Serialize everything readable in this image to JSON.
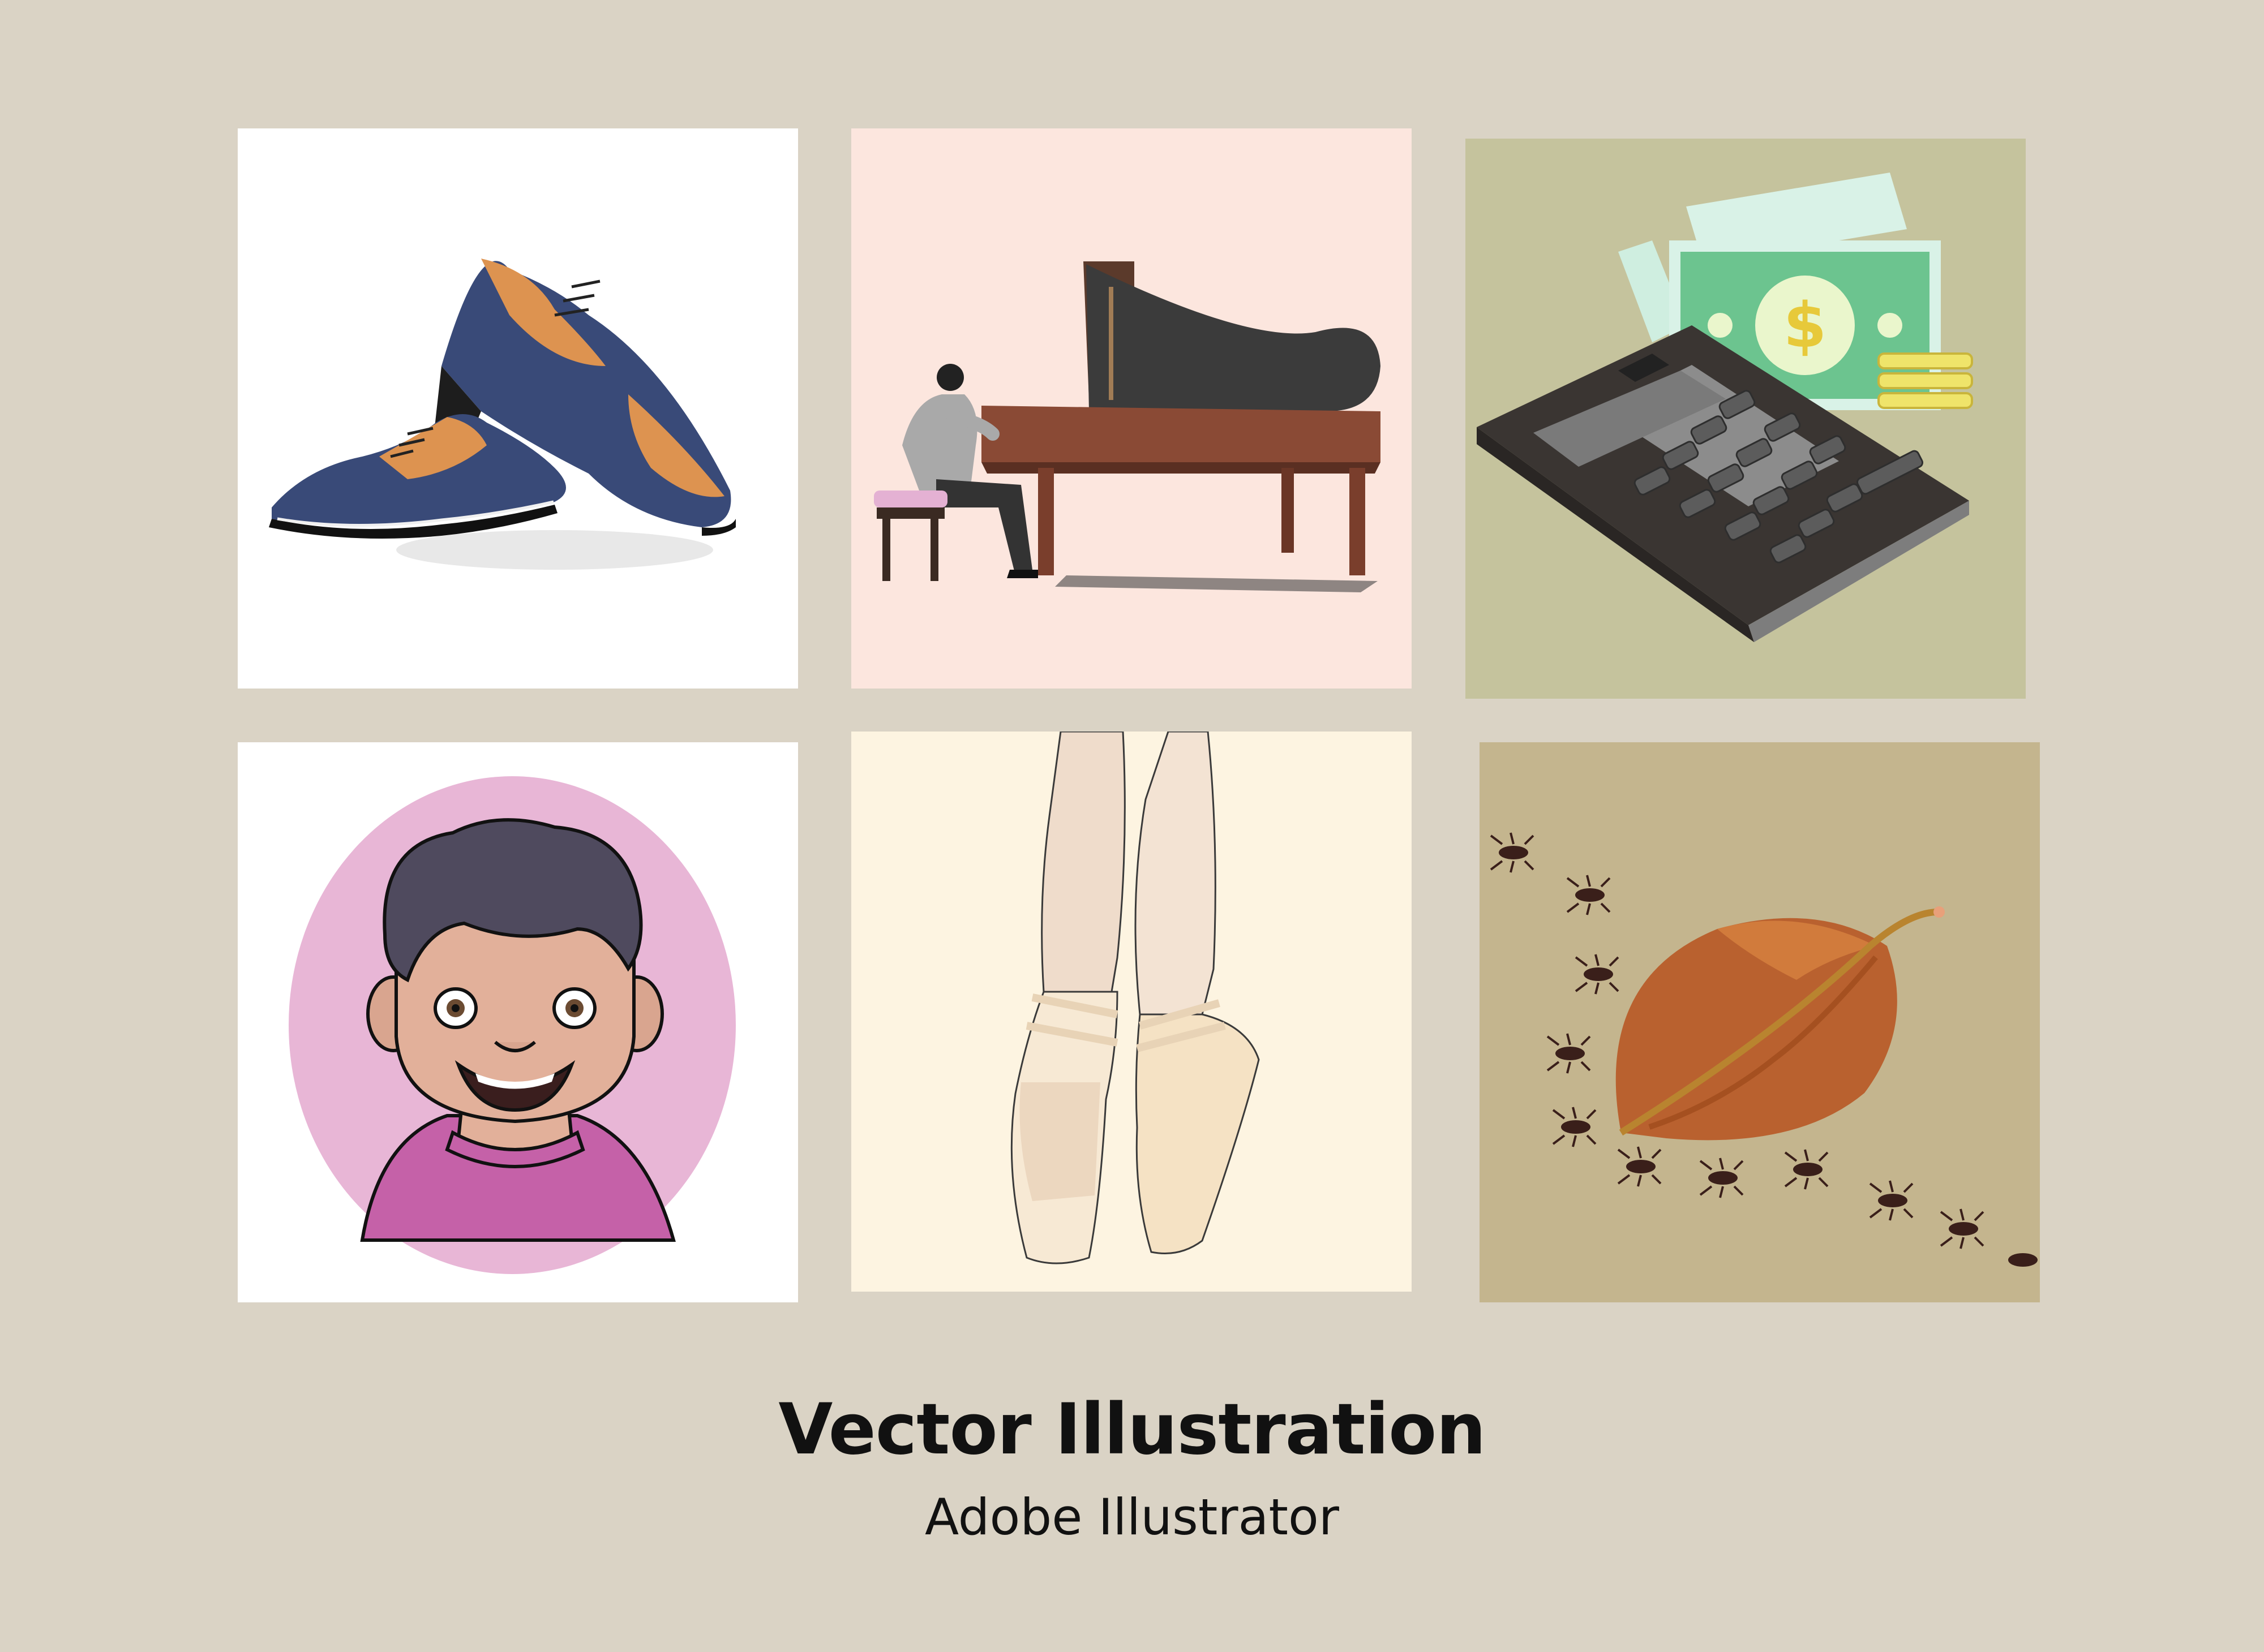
{
  "title": "Vector Illustration",
  "subtitle": "Adobe Illustrator",
  "tiles": [
    {
      "subject": "brogue-shoes",
      "background": "#ffffff"
    },
    {
      "subject": "pianist-at-grand-piano",
      "background": "#fce6de"
    },
    {
      "subject": "calculator-and-money",
      "background": "#c5c39d"
    },
    {
      "subject": "smiling-boy-portrait",
      "background": "#ffffff"
    },
    {
      "subject": "ballet-pointe-shoes",
      "background": "#fdf4e1"
    },
    {
      "subject": "leaf-and-ants",
      "background": "#c4b58e"
    }
  ],
  "money_symbol": "$",
  "colors": {
    "page_background": "#dad3c5",
    "shoe_blue": "#394a78",
    "shoe_tan": "#dd9350",
    "piano_wood": "#8a4a35",
    "bill_green": "#6cc48f",
    "calculator_body": "#3a3532",
    "boy_shirt": "#c561a8",
    "leaf_orange": "#b9612f"
  }
}
